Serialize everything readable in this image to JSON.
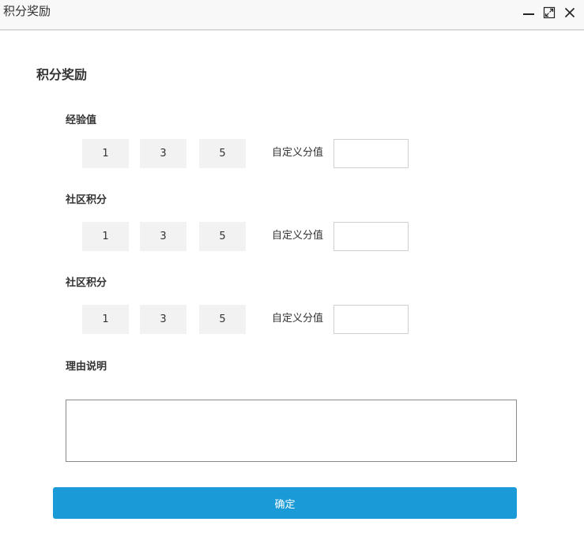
{
  "window": {
    "title": "积分奖励"
  },
  "dialog": {
    "heading": "积分奖励"
  },
  "sections": [
    {
      "label": "经验值",
      "options": [
        "1",
        "3",
        "5"
      ],
      "custom_label": "自定义分值",
      "custom_value": ""
    },
    {
      "label": "社区积分",
      "options": [
        "1",
        "3",
        "5"
      ],
      "custom_label": "自定义分值",
      "custom_value": ""
    },
    {
      "label": "社区积分",
      "options": [
        "1",
        "3",
        "5"
      ],
      "custom_label": "自定义分值",
      "custom_value": ""
    }
  ],
  "reason": {
    "label": "理由说明",
    "value": ""
  },
  "confirm": {
    "label": "确定"
  },
  "colors": {
    "primary": "#1a9bd7",
    "option_bg": "#f2f2f2",
    "titlebar_bg": "#f8f8f8"
  },
  "icons": {
    "minimize": "minimize-icon",
    "maximize": "maximize-icon",
    "close": "close-icon"
  }
}
